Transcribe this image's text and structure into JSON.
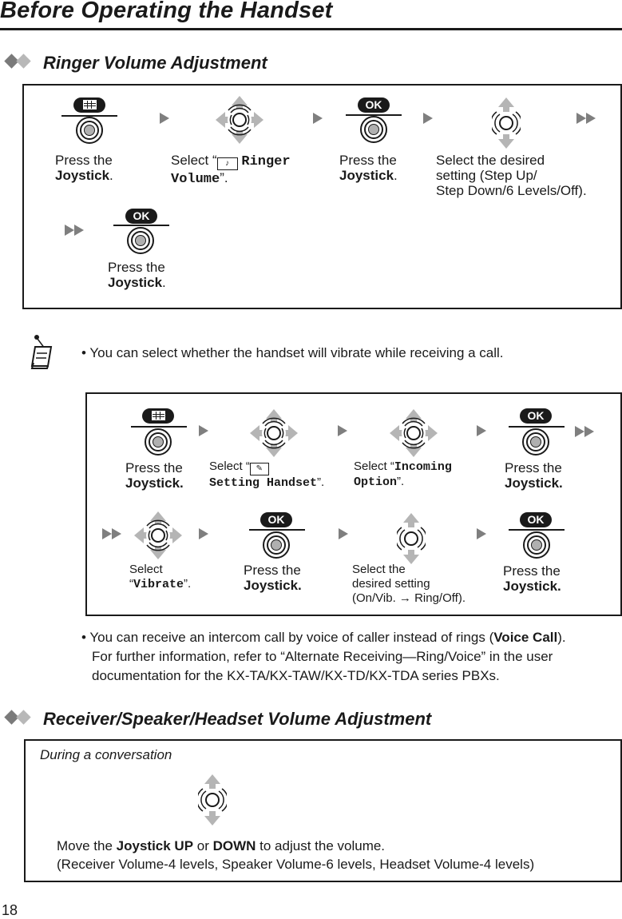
{
  "page": {
    "title": "Before Operating the Handset",
    "page_number": "18"
  },
  "ringer": {
    "heading": "Ringer Volume Adjustment",
    "steps": [
      {
        "icon": "menu-key-joystick",
        "text": "Press the ",
        "bold": "Joystick",
        "suffix": "."
      },
      {
        "icon": "joystick-4way",
        "prefix": "Select “",
        "icon_inline": "ringer-volume-icon",
        "mono": "Ringer Volume",
        "suffix": "”."
      },
      {
        "icon": "ok-key-joystick",
        "text": "Press the ",
        "bold": "Joystick",
        "suffix": "."
      },
      {
        "icon": "joystick-updown",
        "lines": [
          "Select the desired",
          "setting (Step Up/",
          "Step Down/6 Levels/Off)."
        ]
      },
      {
        "icon": "ok-key-joystick",
        "text": "Press the ",
        "bold": "Joystick",
        "suffix": "."
      }
    ],
    "ok_label": "OK"
  },
  "note": {
    "bullet1": "You can select whether the handset will vibrate while receiving a call.",
    "bullet2_a": "You can receive an intercom call by voice of caller instead of rings (",
    "bullet2_bold": "Voice Call",
    "bullet2_b": ").",
    "bullet2_line2": "For further information, refer to “Alternate Receiving—Ring/Voice” in the user",
    "bullet2_line3": "documentation for the KX-TA/KX-TAW/KX-TD/KX-TDA series PBXs."
  },
  "vibrate": {
    "steps": [
      {
        "text": "Press the",
        "bold": "Joystick."
      },
      {
        "prefix": "Select “",
        "mono": "Setting Handset",
        "suffix": "”."
      },
      {
        "prefix": "Select “",
        "mono1": "Incoming",
        "mono2": "Option",
        "suffix": "”."
      },
      {
        "text": "Press the",
        "bold": "Joystick."
      },
      {
        "prefix": "Select",
        "mono": "Vibrate",
        "open": "“",
        "suffix": "”."
      },
      {
        "text": "Press the",
        "bold": "Joystick."
      },
      {
        "lines": [
          "Select the",
          "desired setting",
          "(On/Vib. → Ring/Off)."
        ]
      },
      {
        "text": "Press the",
        "bold": "Joystick."
      }
    ],
    "ok_label": "OK"
  },
  "receiver": {
    "heading": "Receiver/Speaker/Headset Volume Adjustment",
    "context": "During a conversation",
    "line1_a": "Move the ",
    "line1_b": "Joystick UP",
    "line1_c": " or ",
    "line1_d": "DOWN",
    "line1_e": " to adjust the volume.",
    "line2": "(Receiver Volume-4 levels, Speaker Volume-6 levels, Headset Volume-4 levels)"
  }
}
